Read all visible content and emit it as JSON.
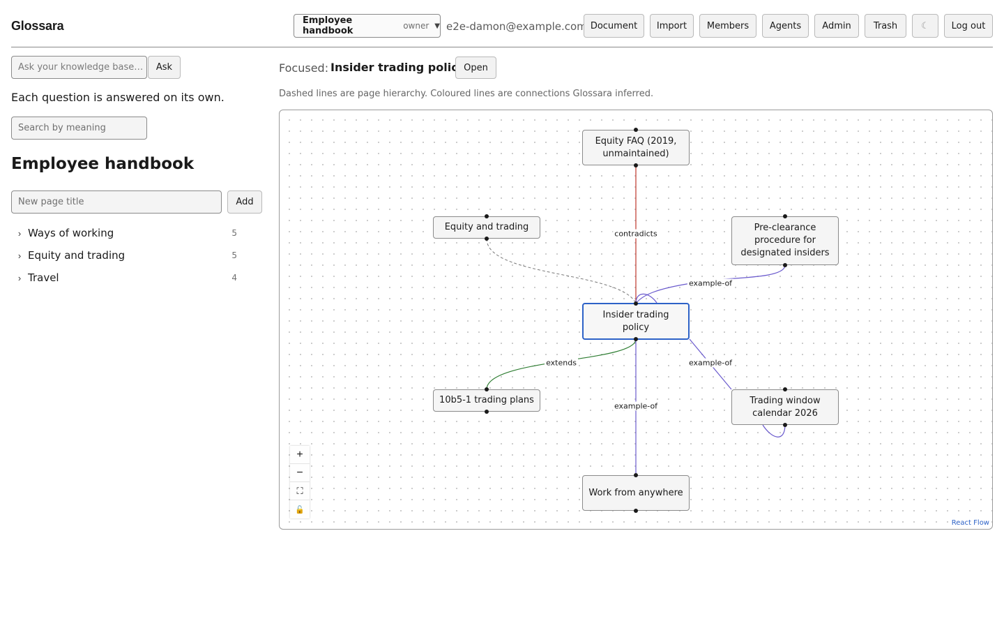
{
  "header": {
    "app_title": "Glossara",
    "kb_select": {
      "name": "Employee handbook",
      "role": "owner"
    },
    "user_email": "e2e-damon@example.com",
    "buttons": {
      "document": "Document",
      "import": "Import",
      "members": "Members",
      "agents": "Agents",
      "admin": "Admin",
      "trash": "Trash",
      "theme": "☾",
      "logout": "Log out"
    }
  },
  "sidebar": {
    "ask_placeholder": "Ask your knowledge base…",
    "ask_button": "Ask",
    "helper_text": "Each question is answered on its own.",
    "search_placeholder": "Search by meaning",
    "kb_heading": "Employee handbook",
    "new_page_placeholder": "New page title",
    "add_button": "Add",
    "tree": [
      {
        "label": "Ways of working",
        "count": "5"
      },
      {
        "label": "Equity and trading",
        "count": "5"
      },
      {
        "label": "Travel",
        "count": "4"
      }
    ]
  },
  "main": {
    "focused_label": "Focused:",
    "focused_title": "Insider trading policy",
    "open_button": "Open",
    "legend_note": "Dashed lines are page hierarchy. Coloured lines are connections Glossara inferred."
  },
  "graph": {
    "nodes": {
      "equity_faq": "Equity FAQ (2019, unmaintained)",
      "equity_trading": "Equity and trading",
      "preclearance": "Pre-clearance procedure for designated insiders",
      "insider": "Insider trading policy",
      "plans_10b5": "10b5-1 trading plans",
      "trading_window": "Trading window calendar 2026",
      "work_anywhere": "Work from anywhere"
    },
    "edge_labels": {
      "contradicts": "contradicts",
      "example_of_preclearance": "example-of",
      "extends": "extends",
      "example_of_window": "example-of",
      "example_of_wfa": "example-of"
    },
    "colors": {
      "contradicts": "#c4443a",
      "example_of": "#6a5acd",
      "extends": "#2e7d32",
      "hierarchy": "#777777",
      "focus": "#2d62c7"
    },
    "controls": {
      "zoom_in": "+",
      "zoom_out": "−",
      "fit": "⛶",
      "lock": "🔓"
    },
    "attribution": "React Flow"
  }
}
